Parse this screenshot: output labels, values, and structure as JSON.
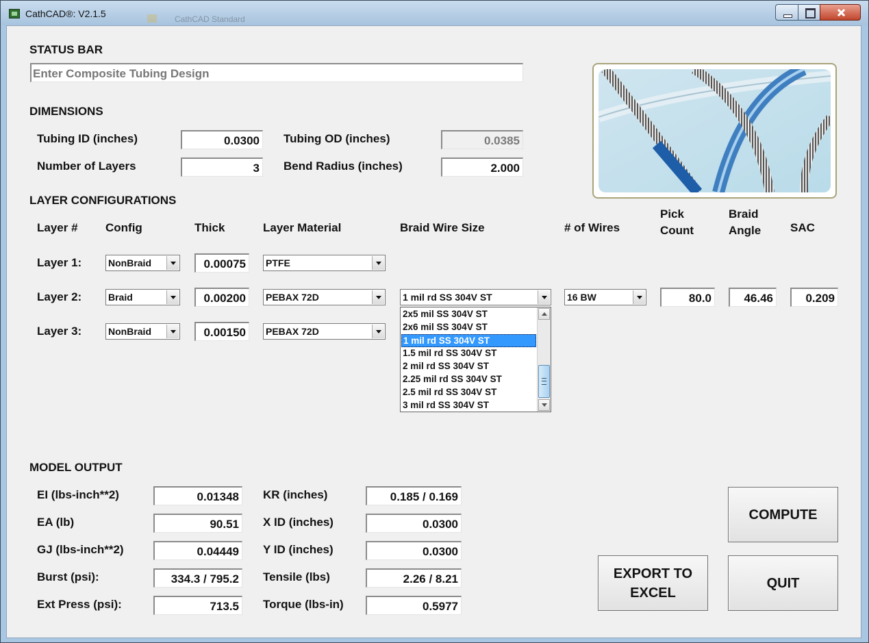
{
  "window": {
    "title": "CathCAD®: V2.1.5",
    "ghost_text": "CathCAD Standard"
  },
  "status_bar": {
    "label": "STATUS BAR",
    "value": "Enter Composite Tubing Design"
  },
  "dimensions": {
    "label": "DIMENSIONS",
    "tubing_id": {
      "label": "Tubing ID (inches)",
      "value": "0.0300"
    },
    "tubing_od": {
      "label": "Tubing OD (inches)",
      "value": "0.0385"
    },
    "num_layers": {
      "label": "Number of Layers",
      "value": "3"
    },
    "bend_radius": {
      "label": "Bend Radius (inches)",
      "value": "2.000"
    }
  },
  "layer_config": {
    "label": "LAYER CONFIGURATIONS",
    "headers": {
      "layer": "Layer #",
      "config": "Config",
      "thick": "Thick",
      "material": "Layer Material",
      "wire_size": "Braid Wire Size",
      "wires": "# of Wires",
      "pick_1": "Pick",
      "pick_2": "Count",
      "angle_1": "Braid",
      "angle_2": "Angle",
      "sac": "SAC"
    },
    "layers": [
      {
        "label": "Layer 1:",
        "config": "NonBraid",
        "thick": "0.00075",
        "material": "PTFE"
      },
      {
        "label": "Layer 2:",
        "config": "Braid",
        "thick": "0.00200",
        "material": "PEBAX 72D",
        "wire_size": "1 mil rd SS 304V ST",
        "wires": "16 BW",
        "pick_count": "80.0",
        "braid_angle": "46.46",
        "sac": "0.209"
      },
      {
        "label": "Layer 3:",
        "config": "NonBraid",
        "thick": "0.00150",
        "material": "PEBAX 72D"
      }
    ],
    "wire_options": [
      "2x5 mil SS 304V ST",
      "2x6 mil SS 304V ST",
      "1 mil rd SS 304V ST",
      "1.5 mil rd SS 304V ST",
      "2 mil rd SS 304V ST",
      "2.25 mil rd SS 304V ST",
      "2.5 mil rd SS 304V ST",
      "3 mil rd SS 304V ST"
    ]
  },
  "model_output": {
    "label": "MODEL OUTPUT",
    "ei": {
      "label": "EI (lbs-inch**2)",
      "value": "0.01348"
    },
    "ea": {
      "label": "EA (lb)",
      "value": "90.51"
    },
    "gj": {
      "label": "GJ (lbs-inch**2)",
      "value": "0.04449"
    },
    "burst": {
      "label": "Burst (psi):",
      "value": "334.3 / 795.2"
    },
    "ext_press": {
      "label": "Ext Press (psi):",
      "value": "713.5"
    },
    "kr": {
      "label": "KR (inches)",
      "value": "0.185 / 0.169"
    },
    "x_id": {
      "label": "X  ID (inches)",
      "value": "0.0300"
    },
    "y_id": {
      "label": "Y  ID (inches)",
      "value": "0.0300"
    },
    "tensile": {
      "label": "Tensile (lbs)",
      "value": "2.26 / 8.21"
    },
    "torque": {
      "label": "Torque (lbs-in)",
      "value": "0.5977"
    }
  },
  "buttons": {
    "compute": "COMPUTE",
    "export_1": "EXPORT TO",
    "export_2": "EXCEL",
    "quit": "QUIT"
  },
  "colors": {
    "selection": "#3399ff",
    "window_frame": "#a9c6e2",
    "client_bg": "#f0f0f0"
  },
  "icons": {
    "app": "cathcad-app-icon",
    "minimize": "minimize-icon",
    "maximize": "maximize-icon",
    "close": "close-icon"
  }
}
